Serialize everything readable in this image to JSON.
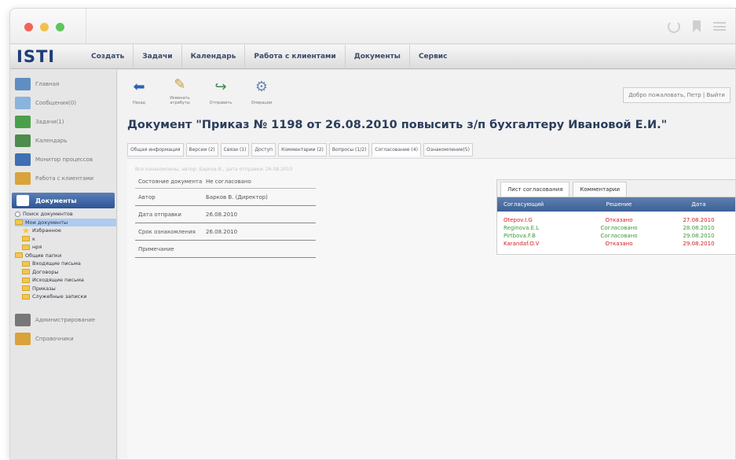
{
  "app": {
    "logo": "ISTI"
  },
  "nav": [
    {
      "label": "Создать",
      "name": "nav-create"
    },
    {
      "label": "Задачи",
      "name": "nav-tasks"
    },
    {
      "label": "Календарь",
      "name": "nav-calendar"
    },
    {
      "label": "Работа с клиентами",
      "name": "nav-clients"
    },
    {
      "label": "Документы",
      "name": "nav-documents"
    },
    {
      "label": "Сервис",
      "name": "nav-service"
    }
  ],
  "sidebar": {
    "items_top": [
      {
        "label": "Главная",
        "icon": "home-icon",
        "color": "#5f8fc2"
      },
      {
        "label": "Сообщения(0)",
        "icon": "mail-icon",
        "color": "#8ab3dd"
      },
      {
        "label": "Задачи(1)",
        "icon": "tasks-icon",
        "color": "#4aa04a"
      },
      {
        "label": "Календарь",
        "icon": "calendar-icon",
        "color": "#4c8c4c"
      },
      {
        "label": "Монитор процессов",
        "icon": "monitor-icon",
        "color": "#3f6fb5"
      },
      {
        "label": "Работа с клиентами",
        "icon": "clients-icon",
        "color": "#d9a23a"
      }
    ],
    "section_label": "Документы",
    "tree": [
      {
        "label": "Поиск документов",
        "indent": 0,
        "icon": "search-icon"
      },
      {
        "label": "Мои документы",
        "indent": 0,
        "icon": "folder-icon",
        "selected": true
      },
      {
        "label": "Избранное",
        "indent": 1,
        "icon": "star-icon"
      },
      {
        "label": "к",
        "indent": 1,
        "icon": "folder-icon"
      },
      {
        "label": "нря",
        "indent": 1,
        "icon": "folder-icon"
      },
      {
        "label": "Общие папки",
        "indent": 0,
        "icon": "folder-icon"
      },
      {
        "label": "Входящие письма",
        "indent": 1,
        "icon": "folder-icon"
      },
      {
        "label": "Договоры",
        "indent": 1,
        "icon": "folder-icon"
      },
      {
        "label": "Исходящие письма",
        "indent": 1,
        "icon": "folder-icon"
      },
      {
        "label": "Приказы",
        "indent": 1,
        "icon": "folder-icon"
      },
      {
        "label": "Служебные записки",
        "indent": 1,
        "icon": "folder-icon"
      }
    ],
    "items_bottom": [
      {
        "label": "Администрирование",
        "icon": "admin-icon",
        "color": "#777"
      },
      {
        "label": "Справочники",
        "icon": "reference-icon",
        "color": "#d9a23a"
      }
    ]
  },
  "toolbar": {
    "back": "Назад",
    "edit": "Изменить атрибуты",
    "send": "Отправить",
    "ops": "Операции"
  },
  "welcome": "Добро пожаловать, Петр | Выйти",
  "document_title": "Документ  \"Приказ № 1198 от 26.08.2010 повысить з/п бухгалтеру Ивановой Е.И.\"",
  "tabs": [
    "Общая информация",
    "Версии (2)",
    "Связи (1)",
    "Доступ",
    "Комментарии (2)",
    "Вопросы (1/2)",
    "Согласование (4)",
    "Ознакомление(5)"
  ],
  "active_tab_index": 6,
  "faded_note": "Все ознакомлены, автор: Барков В., дата отправки: 26.08.2010",
  "info": [
    {
      "key": "Состояние документа",
      "value": "Не согласовано"
    },
    {
      "key": "Автор",
      "value": "Барков В. (Директор)"
    },
    {
      "key": "Дата отправки",
      "value": "26.08.2010"
    },
    {
      "key": "Срок ознакомления",
      "value": "26.08.2010"
    },
    {
      "key": "Примечание",
      "value": ""
    }
  ],
  "approval": {
    "tabs": [
      "Лист согласования",
      "Комментарии"
    ],
    "headers": [
      "Согласующий",
      "Решение",
      "Дата"
    ],
    "rows": [
      {
        "name": "Otepov.I.G",
        "decision": "Отказано",
        "date": "27.08.2010",
        "color": "#d22020"
      },
      {
        "name": "Reginova.E.L",
        "decision": "Согласовано",
        "date": "28.08.2010",
        "color": "#3a9a3a"
      },
      {
        "name": "Pirtbova.F.B",
        "decision": "Согласовано",
        "date": "29.08.2010",
        "color": "#3a9a3a"
      },
      {
        "name": "Karandaf.O.V",
        "decision": "Отказано",
        "date": "29.08.2010",
        "color": "#d22020"
      }
    ]
  }
}
